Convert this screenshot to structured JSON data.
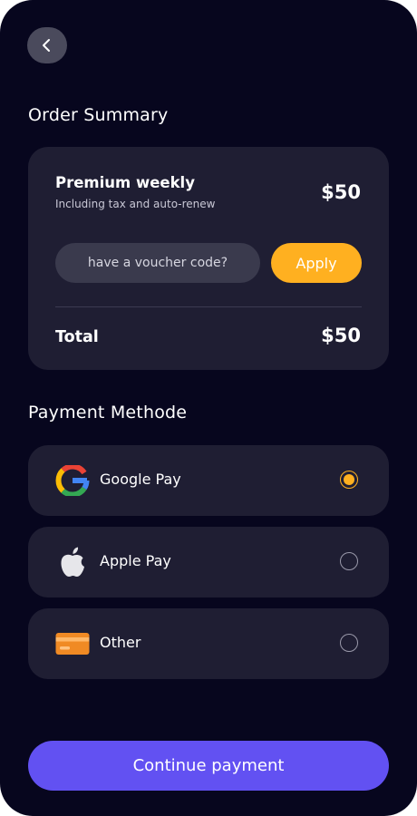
{
  "header": {
    "back_icon": "chevron-left-icon"
  },
  "order_summary": {
    "title": "Order Summary",
    "plan_name": "Premium weekly",
    "plan_subtitle": "Including tax and auto-renew",
    "plan_price": "$50",
    "voucher": {
      "value": "",
      "placeholder": "have a voucher code?"
    },
    "apply_label": "Apply",
    "total_label": "Total",
    "total_value": "$50"
  },
  "payment": {
    "title": "Payment Methode",
    "options": [
      {
        "label": "Google Pay",
        "icon": "google-icon",
        "selected": true
      },
      {
        "label": "Apple Pay",
        "icon": "apple-icon",
        "selected": false
      },
      {
        "label": "Other",
        "icon": "credit-card-icon",
        "selected": false
      }
    ]
  },
  "continue_label": "Continue payment",
  "colors": {
    "background": "#07061e",
    "card": "#1f1e33",
    "accent_yellow": "#ffb020",
    "primary_purple": "#6251f2"
  }
}
